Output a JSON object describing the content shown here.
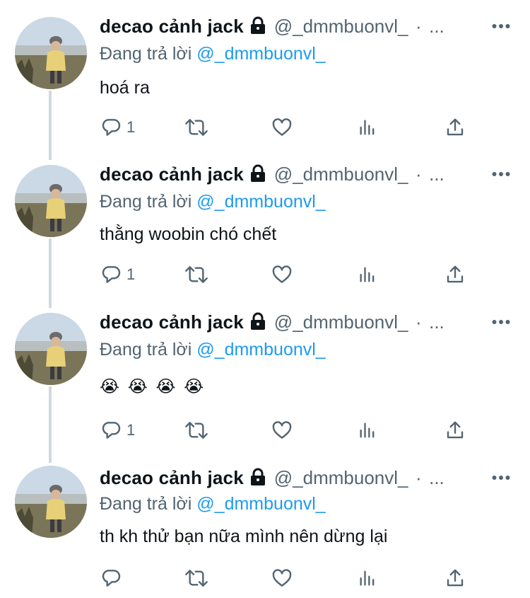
{
  "thread": {
    "tweets": [
      {
        "display_name": "decao cảnh jack",
        "handle": "@_dmmbuonvl_",
        "separator": "·",
        "more_glyph": "...",
        "replying_prefix": "Đang trả lời",
        "replying_to": "@_dmmbuonvl_",
        "text": "hoá ra",
        "reply_count": "1"
      },
      {
        "display_name": "decao cảnh jack",
        "handle": "@_dmmbuonvl_",
        "separator": "·",
        "more_glyph": "...",
        "replying_prefix": "Đang trả lời",
        "replying_to": "@_dmmbuonvl_",
        "text": "thằng woobin chó chết",
        "reply_count": "1"
      },
      {
        "display_name": "decao cảnh jack",
        "handle": "@_dmmbuonvl_",
        "separator": "·",
        "more_glyph": "...",
        "replying_prefix": "Đang trả lời",
        "replying_to": "@_dmmbuonvl_",
        "emojis": [
          "😭",
          "😭",
          "😭",
          "😭"
        ],
        "reply_count": "1"
      },
      {
        "display_name": "decao cảnh jack",
        "handle": "@_dmmbuonvl_",
        "separator": "·",
        "more_glyph": "...",
        "replying_prefix": "Đang trả lời",
        "replying_to": "@_dmmbuonvl_",
        "text": "th kh thử bạn nữa mình nên dừng lại",
        "reply_count": ""
      }
    ]
  },
  "icons": {
    "lock": "lock-icon",
    "more": "more-horizontal-icon",
    "reply": "reply-icon",
    "retweet": "retweet-icon",
    "like": "heart-icon",
    "views": "views-icon",
    "share": "share-icon"
  },
  "colors": {
    "text_primary": "#0f1419",
    "text_secondary": "#536471",
    "mention": "#1d9bf0",
    "thread_line": "#cfd9de"
  }
}
